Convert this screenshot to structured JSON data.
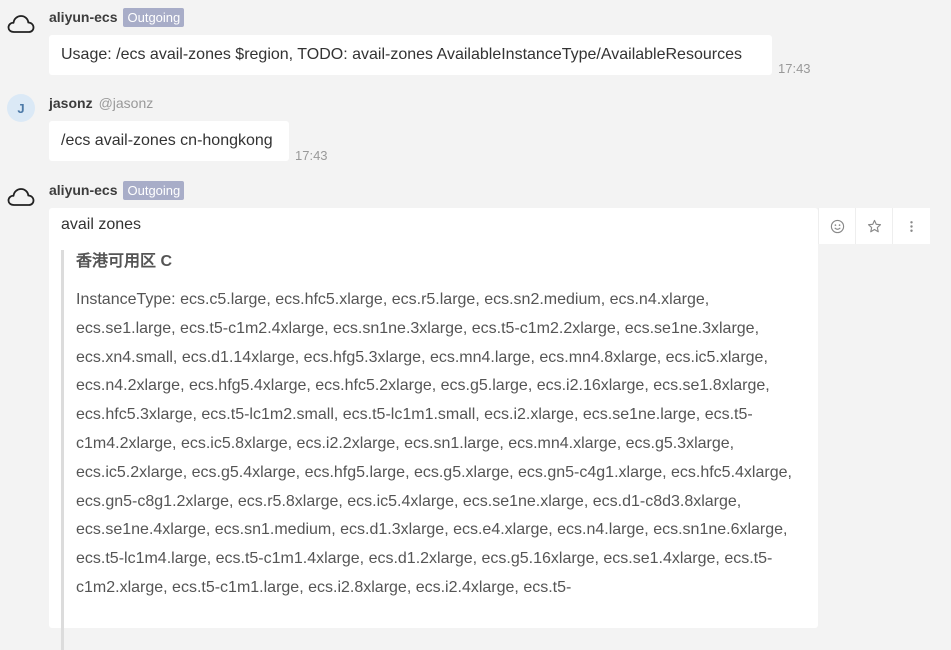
{
  "messages": [
    {
      "sender": "aliyun-ecs",
      "badge": "Outgoing",
      "text": "Usage: /ecs avail-zones $region, TODO: avail-zones AvailableInstanceType/AvailableResources",
      "time": "17:43"
    },
    {
      "sender": "jasonz",
      "avatar_letter": "J",
      "handle": "@jasonz",
      "text": "/ecs avail-zones cn-hongkong",
      "time": "17:43"
    },
    {
      "sender": "aliyun-ecs",
      "badge": "Outgoing",
      "title": "avail zones",
      "zone_name": "香港可用区 C",
      "instance_types": "InstanceType: ecs.c5.large, ecs.hfc5.xlarge, ecs.r5.large, ecs.sn2.medium, ecs.n4.xlarge, ecs.se1.large, ecs.t5-c1m2.4xlarge, ecs.sn1ne.3xlarge, ecs.t5-c1m2.2xlarge, ecs.se1ne.3xlarge, ecs.xn4.small, ecs.d1.14xlarge, ecs.hfg5.3xlarge, ecs.mn4.large, ecs.mn4.8xlarge, ecs.ic5.xlarge, ecs.n4.2xlarge, ecs.hfg5.4xlarge, ecs.hfc5.2xlarge, ecs.g5.large, ecs.i2.16xlarge, ecs.se1.8xlarge, ecs.hfc5.3xlarge, ecs.t5-lc1m2.small, ecs.t5-lc1m1.small, ecs.i2.xlarge, ecs.se1ne.large, ecs.t5-c1m4.2xlarge, ecs.ic5.8xlarge, ecs.i2.2xlarge, ecs.sn1.large, ecs.mn4.xlarge, ecs.g5.3xlarge, ecs.ic5.2xlarge, ecs.g5.4xlarge, ecs.hfg5.large, ecs.g5.xlarge, ecs.gn5-c4g1.xlarge, ecs.hfc5.4xlarge, ecs.gn5-c8g1.2xlarge, ecs.r5.8xlarge, ecs.ic5.4xlarge, ecs.se1ne.xlarge, ecs.d1-c8d3.8xlarge, ecs.se1ne.4xlarge, ecs.sn1.medium, ecs.d1.3xlarge, ecs.e4.xlarge, ecs.n4.large, ecs.sn1ne.6xlarge, ecs.t5-lc1m4.large, ecs.t5-c1m1.4xlarge, ecs.d1.2xlarge, ecs.g5.16xlarge, ecs.se1.4xlarge, ecs.t5-c1m2.xlarge, ecs.t5-c1m1.large, ecs.i2.8xlarge, ecs.i2.4xlarge, ecs.t5-"
    }
  ],
  "actions": [
    {
      "icon": "smiley-icon"
    },
    {
      "icon": "star-icon"
    },
    {
      "icon": "more-vertical-icon"
    }
  ]
}
